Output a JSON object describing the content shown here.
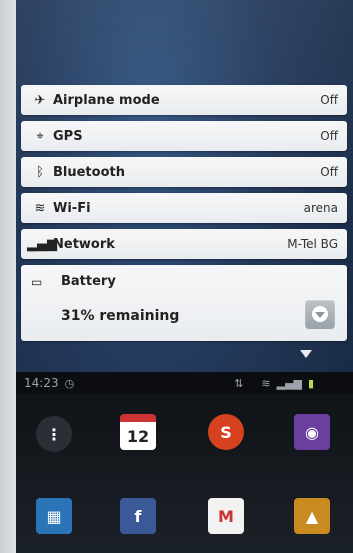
{
  "quick_settings": {
    "rows": [
      {
        "icon": "airplane-icon",
        "glyph": "✈",
        "label": "Airplane mode",
        "value": "Off"
      },
      {
        "icon": "gps-icon",
        "glyph": "⌖",
        "label": "GPS",
        "value": "Off"
      },
      {
        "icon": "bluetooth-icon",
        "glyph": "ᛒ",
        "label": "Bluetooth",
        "value": "Off"
      },
      {
        "icon": "wifi-icon",
        "glyph": "≋",
        "label": "Wi-Fi",
        "value": "arena"
      },
      {
        "icon": "network-signal-icon",
        "glyph": "▂▄▆",
        "label": "Network",
        "value": "M-Tel BG"
      }
    ],
    "battery": {
      "icon": "battery-icon",
      "glyph": "▭",
      "title": "Battery",
      "remaining": "31% remaining"
    }
  },
  "status_bar": {
    "time": "14:23",
    "icons": [
      "clock-icon",
      "data-icon",
      "wifi-icon",
      "signal-icon",
      "battery-icon"
    ]
  },
  "home": {
    "calendar_label": "12",
    "apps": [
      "apps-icon",
      "calendar-icon",
      "music-icon",
      "camera-icon",
      "browser-icon",
      "facebook-icon",
      "gmail-icon",
      "gallery-icon"
    ]
  },
  "colors": {
    "panel": "#f0f2f4",
    "screen": "#23385a",
    "statusbar": "#0b0d10"
  }
}
